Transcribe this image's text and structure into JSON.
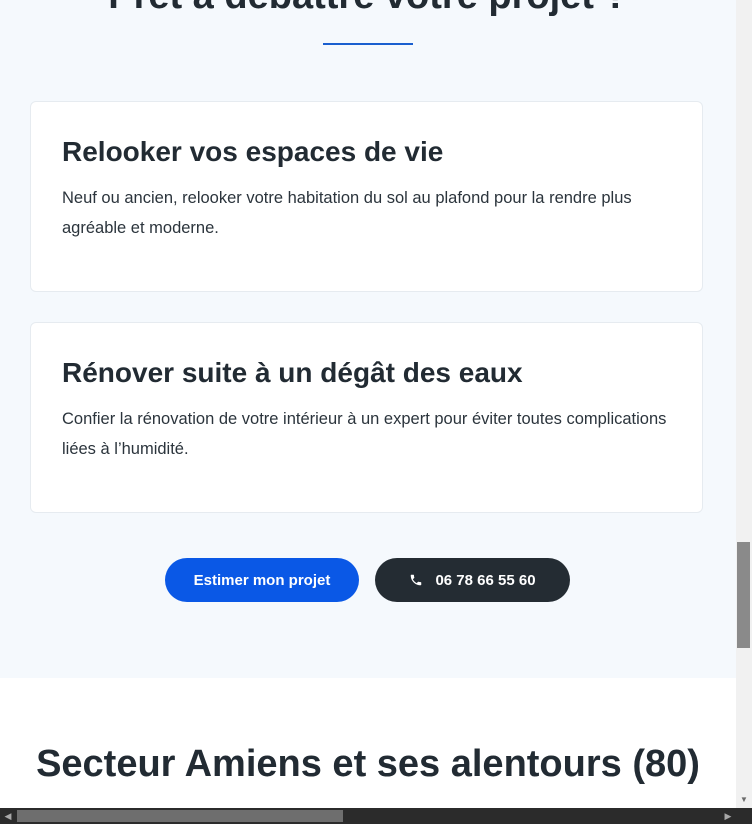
{
  "hero": {
    "title": "Prêt à débattre votre projet ?"
  },
  "cards": [
    {
      "title": "Relooker vos espaces de vie",
      "text": "Neuf ou ancien, relooker votre habitation du sol au plafond pour la rendre plus agréable et moderne."
    },
    {
      "title": "Rénover suite à un dégât des eaux",
      "text": "Confier la rénovation de votre intérieur à un expert pour éviter toutes complications liées à l’humidité."
    }
  ],
  "cta": {
    "estimate_label": "Estimer mon projet",
    "phone_label": "06 78 66 55 60",
    "phone_icon": "phone-icon"
  },
  "sector": {
    "title": "Secteur Amiens et ses alentours (80)"
  },
  "colors": {
    "accent": "#0a58e6",
    "dark_button": "#242c33",
    "section_bg": "#f5f9fd",
    "rule": "#1a5fcf",
    "text": "#222b33"
  }
}
